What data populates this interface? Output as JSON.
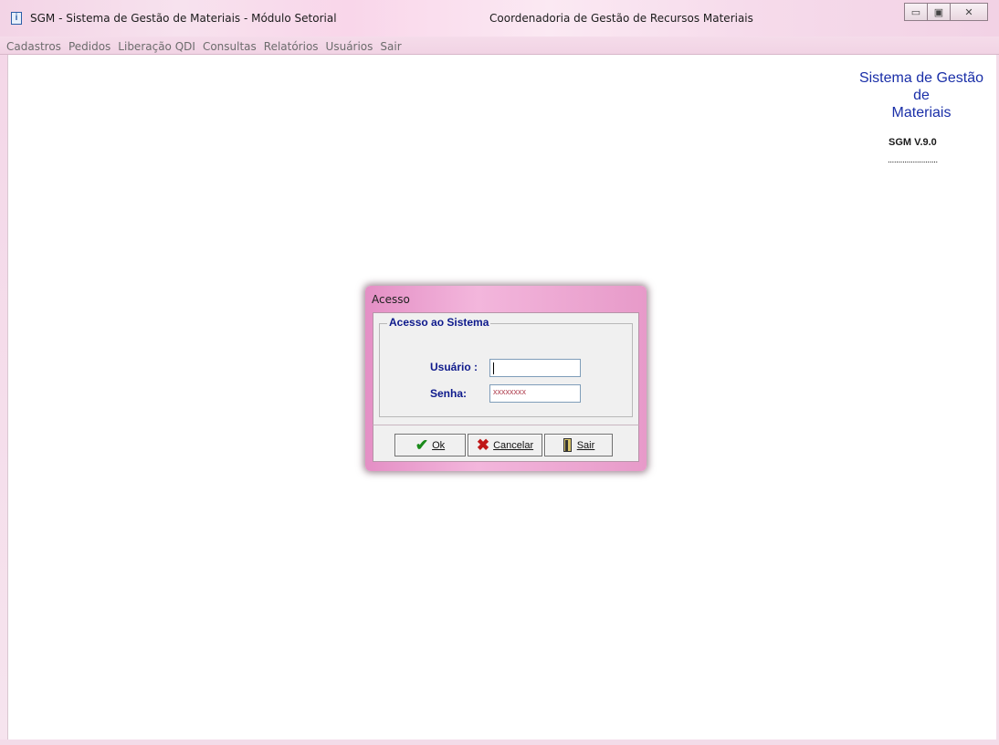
{
  "window": {
    "title": "SGM - Sistema de Gestão de  Materiais - Módulo Setorial",
    "center_title": "Coordenadoria de Gestão de Recursos Materiais",
    "icon": "app-icon"
  },
  "menu": {
    "items": [
      "Cadastros",
      "Pedidos",
      "Liberação QDI",
      "Consultas",
      "Relatórios",
      "Usuários",
      "Sair"
    ]
  },
  "brand": {
    "line1": "Sistema de Gestão",
    "line2": "de",
    "line3": "Materiais",
    "version": "SGM  V.9.0",
    "dots": "........................"
  },
  "dialog": {
    "title": "Acesso",
    "group_title": "Acesso ao Sistema",
    "usuario_label": "Usuário :",
    "usuario_value": "",
    "senha_label": "Senha:",
    "senha_value": "xxxxxxxx",
    "buttons": {
      "ok": "Ok",
      "cancelar": "Cancelar",
      "sair": "Sair"
    }
  }
}
